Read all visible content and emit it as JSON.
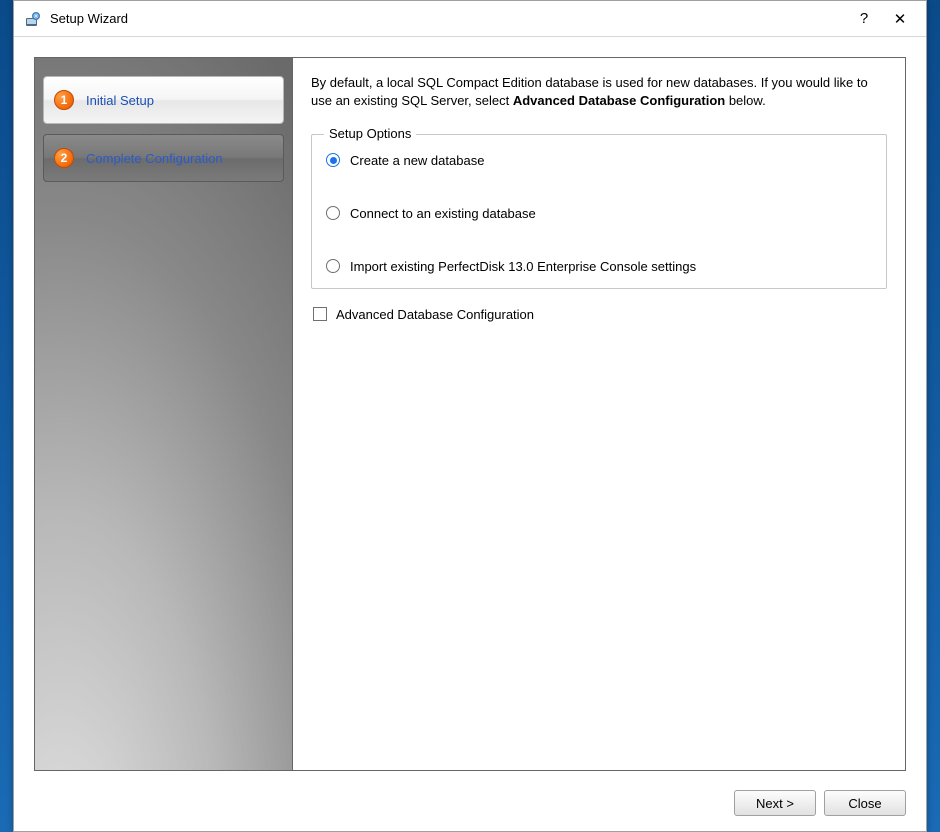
{
  "window": {
    "title": "Setup Wizard",
    "help_symbol": "?",
    "close_symbol": "✕"
  },
  "sidebar": {
    "steps": [
      {
        "num": "1",
        "label": "Initial Setup",
        "active": true
      },
      {
        "num": "2",
        "label": "Complete Configuration",
        "active": false
      }
    ]
  },
  "main": {
    "intro_part1": "By default, a local SQL Compact Edition database is used for new databases. If you would like to use an existing SQL Server, select ",
    "intro_bold": "Advanced Database Configuration",
    "intro_part2": " below.",
    "fieldset_legend": "Setup Options",
    "options": [
      {
        "label": "Create a new database",
        "checked": true
      },
      {
        "label": "Connect to an existing database",
        "checked": false
      },
      {
        "label": "Import existing PerfectDisk 13.0 Enterprise Console settings",
        "checked": false
      }
    ],
    "advanced_checkbox": {
      "label": "Advanced Database Configuration",
      "checked": false
    }
  },
  "footer": {
    "next_label": "Next >",
    "close_label": "Close"
  }
}
